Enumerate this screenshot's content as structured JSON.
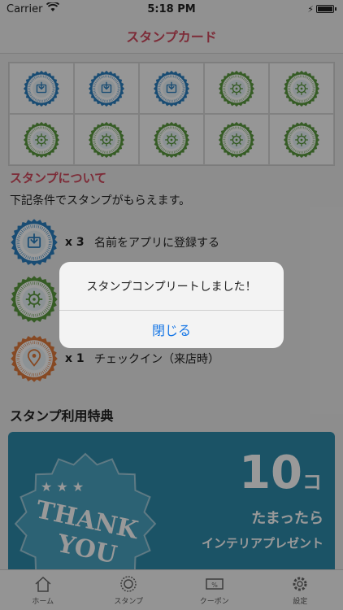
{
  "status_bar": {
    "carrier": "Carrier",
    "time": "5:18 PM"
  },
  "navbar": {
    "title": "スタンプカード"
  },
  "stamp_grid": {
    "stamps": [
      "download",
      "download",
      "download",
      "gear",
      "gear",
      "gear",
      "gear",
      "gear",
      "gear",
      "gear"
    ]
  },
  "about": {
    "title": "スタンプについて",
    "description": "下記条件でスタンプがもらえます。",
    "rules": [
      {
        "icon": "download",
        "count": "x 3",
        "text": "名前をアプリに登録する"
      },
      {
        "icon": "gear",
        "count": "",
        "text": ""
      },
      {
        "icon": "location",
        "count": "x 1",
        "text": "チェックイン（来店時）"
      }
    ]
  },
  "benefits": {
    "title": "スタンプ利用特典",
    "badge_line1": "THANK",
    "badge_line2": "YOU",
    "number": "10",
    "unit": "コ",
    "line1": "たまったら",
    "line2": "インテリアプレゼント"
  },
  "tabs": [
    {
      "icon": "home-icon",
      "label": "ホーム"
    },
    {
      "icon": "stamp-icon",
      "label": "スタンプ"
    },
    {
      "icon": "coupon-icon",
      "label": "クーポン"
    },
    {
      "icon": "settings-icon",
      "label": "設定"
    }
  ],
  "alert": {
    "message": "スタンプコンプリートしました！",
    "button": "閉じる"
  },
  "colors": {
    "accent": "#d04a5e",
    "stamp_blue": "#2a7fc0",
    "stamp_green": "#5a9a3f",
    "stamp_orange": "#e07b3c",
    "banner": "#2e8bab",
    "link": "#1576e6"
  }
}
